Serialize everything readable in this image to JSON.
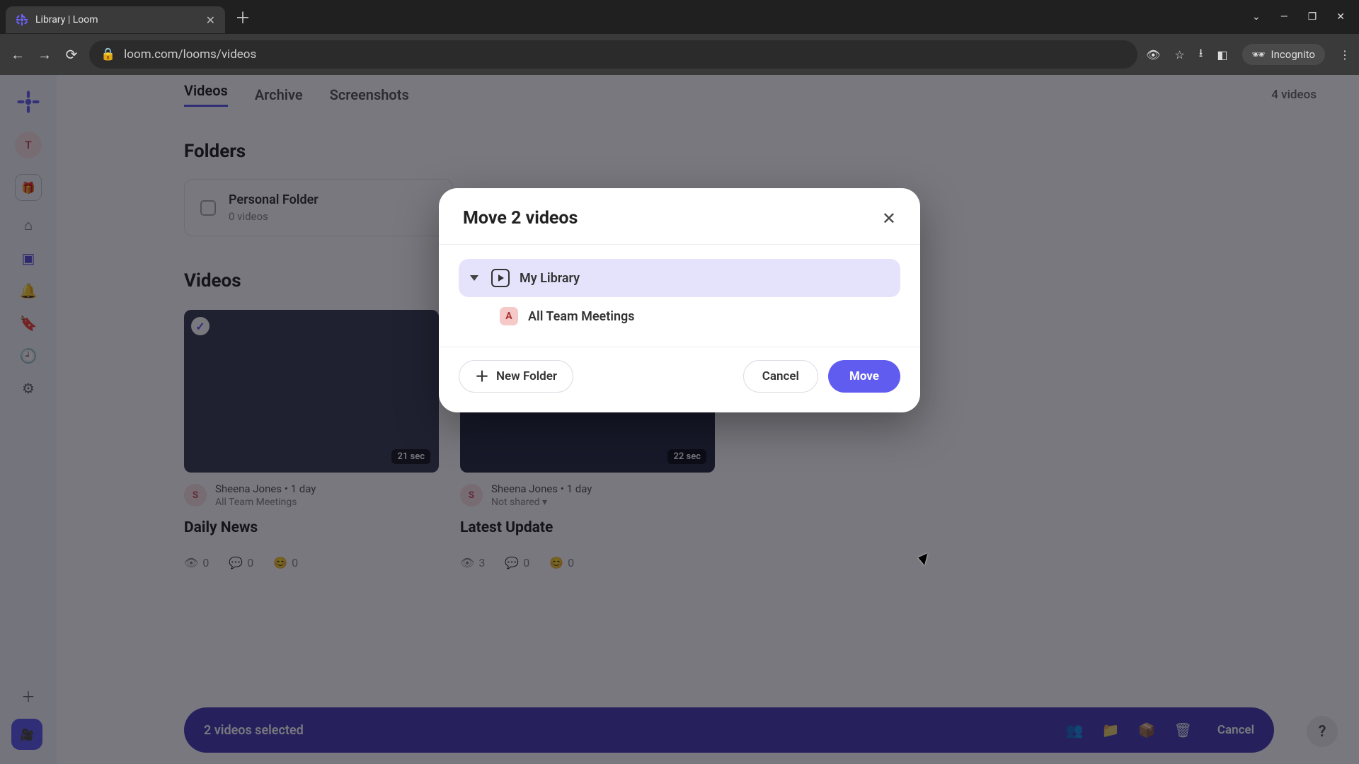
{
  "browser": {
    "tab_title": "Library | Loom",
    "url": "loom.com/looms/videos",
    "incognito_label": "Incognito"
  },
  "rail": {
    "avatar_initial": "T",
    "workspace_initial": "A"
  },
  "page": {
    "tabs": {
      "videos": "Videos",
      "archive": "Archive",
      "screenshots": "Screenshots"
    },
    "video_count": "4 videos",
    "folders_heading": "Folders",
    "personal_folder": {
      "name": "Personal Folder",
      "sub": "0 videos"
    },
    "videos_heading": "Videos"
  },
  "videos": [
    {
      "duration": "21 sec",
      "author": "Sheena Jones",
      "age": "• 1 day",
      "shared": "All Team Meetings",
      "title": "Daily News",
      "views": "0",
      "comments": "0",
      "reactions": "0",
      "avatar_initial": "S"
    },
    {
      "duration": "22 sec",
      "author": "Sheena Jones",
      "age": "• 1 day",
      "shared": "Not shared ▾",
      "title": "Latest Update",
      "views": "3",
      "comments": "0",
      "reactions": "0",
      "avatar_initial": "S"
    }
  ],
  "selection_bar": {
    "text": "2 videos selected",
    "cancel": "Cancel"
  },
  "modal": {
    "title": "Move 2 videos",
    "library_label": "My Library",
    "subfolder_label": "All Team Meetings",
    "subfolder_initial": "A",
    "new_folder": "New Folder",
    "cancel": "Cancel",
    "move": "Move"
  }
}
